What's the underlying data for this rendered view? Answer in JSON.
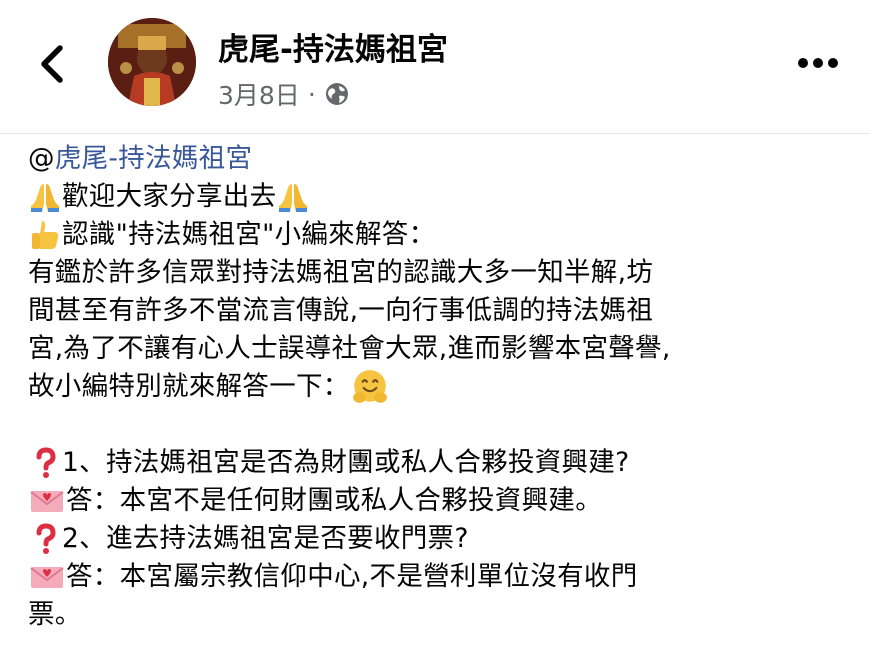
{
  "header": {
    "page_name": "虎尾-持法媽祖宮",
    "date": "3月8日",
    "separator": "·",
    "privacy_icon": "globe-icon",
    "back_icon": "chevron-left-icon",
    "more_icon": "more-horizontal-icon"
  },
  "post": {
    "mention_at": "@",
    "mention_name": "虎尾-持法媽祖宮",
    "line_welcome": "歡迎大家分享出去",
    "line_intro": "認識\"持法媽祖宮\"小編來解答：",
    "para_line1": "有鑑於許多信眾對持法媽祖宮的認識大多一知半解,坊",
    "para_line2": "間甚至有許多不當流言傳說,一向行事低調的持法媽祖",
    "para_line3": "宮,為了不讓有心人士誤導社會大眾,進而影響本宮聲譽,",
    "para_line4": "故小編特別就來解答一下：",
    "q1": "1、持法媽祖宮是否為財團或私人合夥投資興建?",
    "a1": "答：本宮不是任何財團或私人合夥投資興建。",
    "q2": "2、進去持法媽祖宮是否要收門票?",
    "a2_line1": "答：本宮屬宗教信仰中心,不是營利單位沒有收門",
    "a2_line2": "票。"
  },
  "colors": {
    "mention": "#385898",
    "meta_text": "#65676b",
    "question_mark": "#dd2e44",
    "heart_envelope": "#f4abba"
  }
}
